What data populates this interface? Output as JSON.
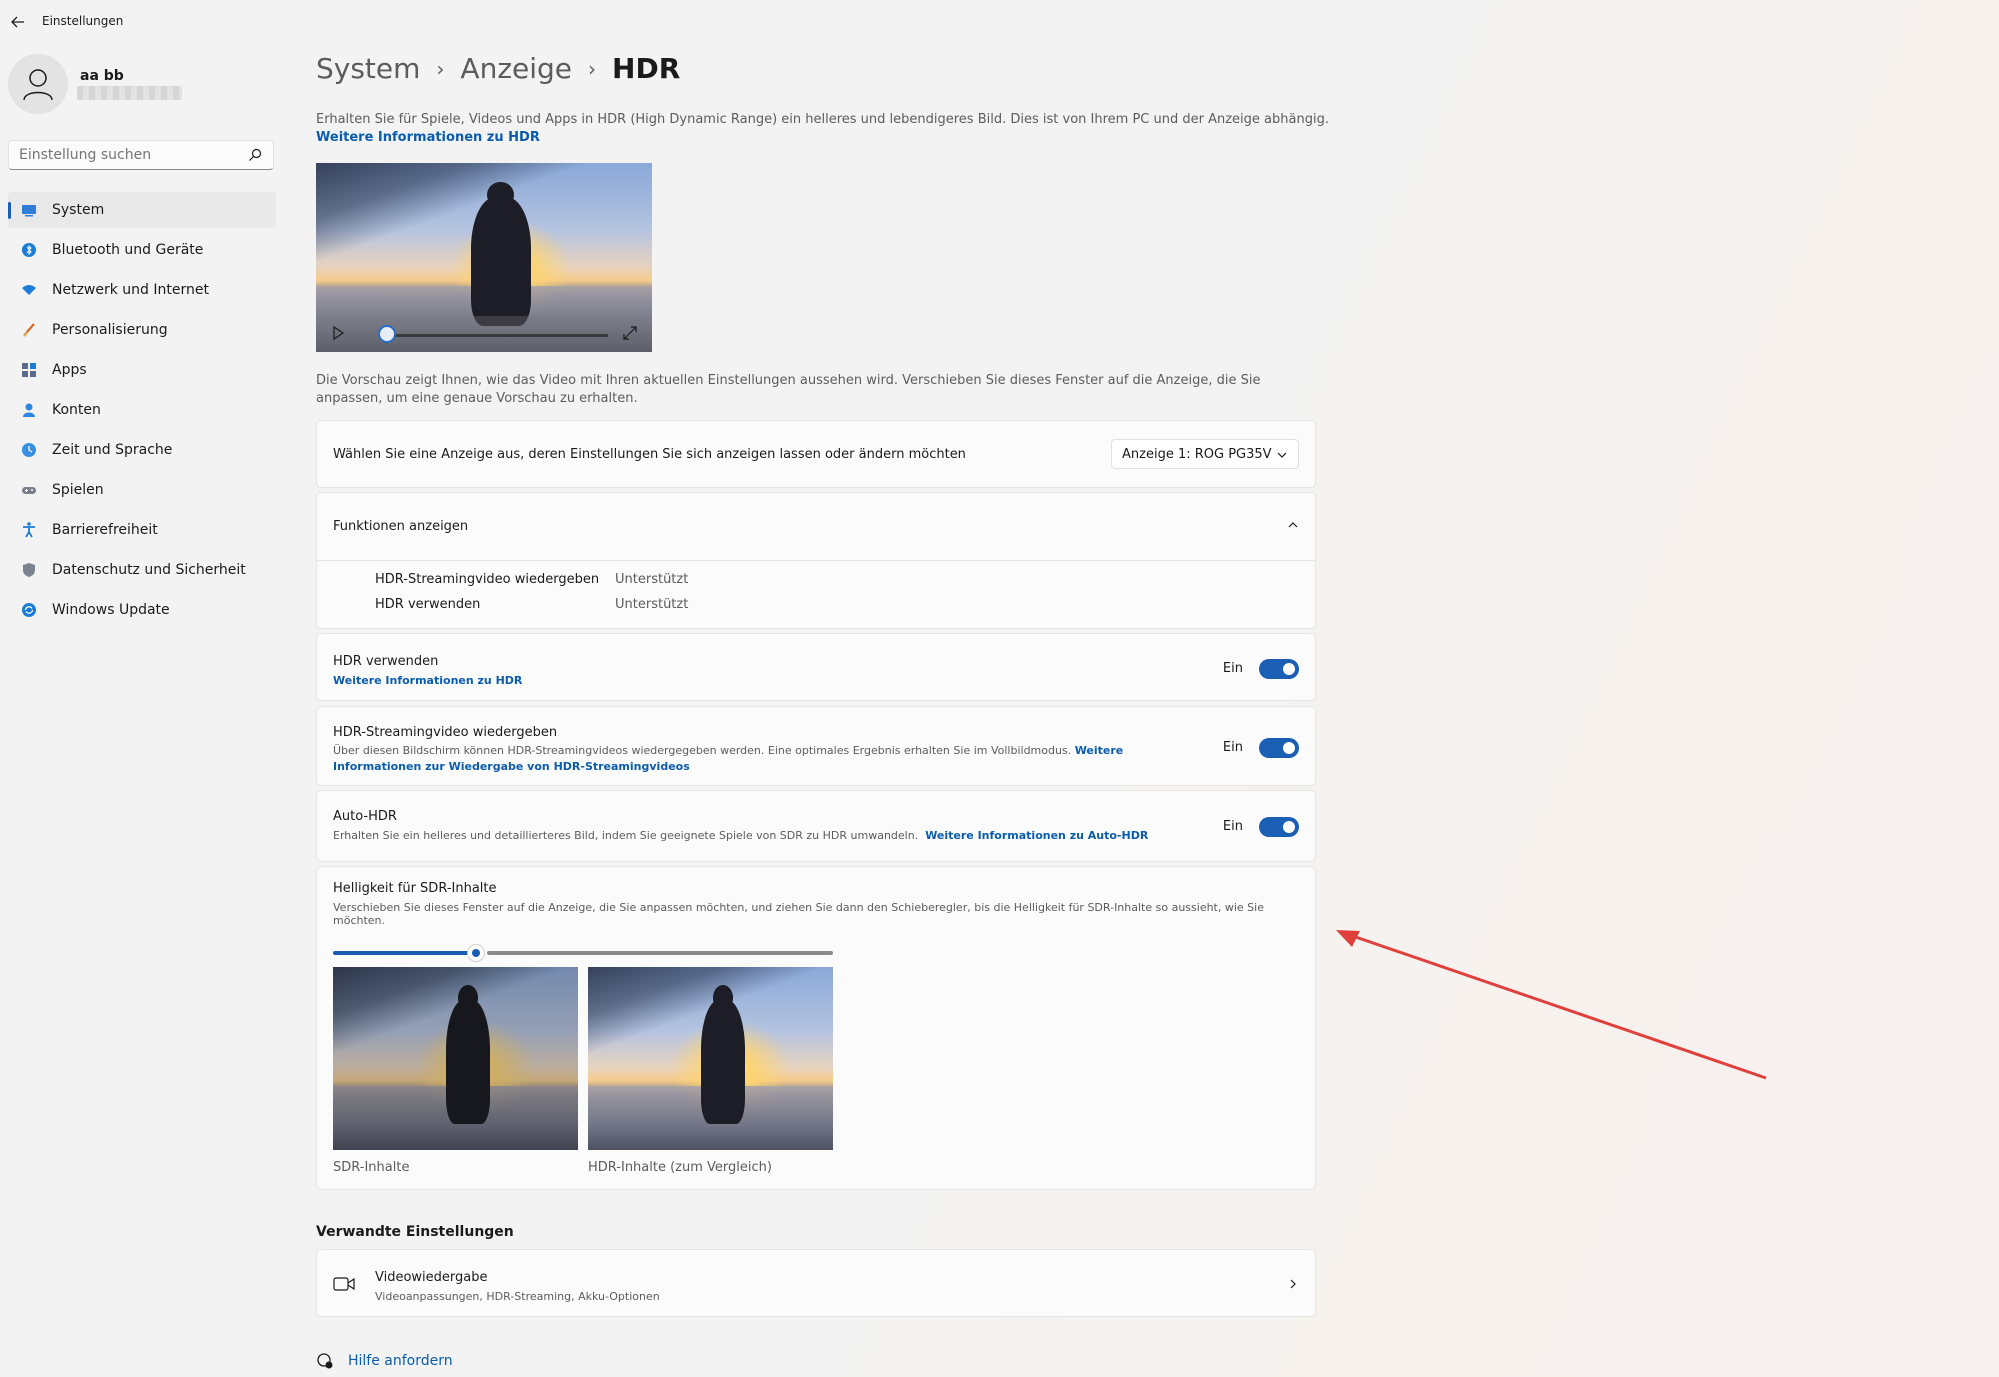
{
  "window": {
    "title": "Einstellungen"
  },
  "user": {
    "name": "aa bb"
  },
  "search": {
    "placeholder": "Einstellung suchen"
  },
  "sidebar": {
    "items": [
      {
        "label": "System",
        "icon": "monitor-icon",
        "active": true
      },
      {
        "label": "Bluetooth und Geräte",
        "icon": "bluetooth-icon"
      },
      {
        "label": "Netzwerk und Internet",
        "icon": "wifi-icon"
      },
      {
        "label": "Personalisierung",
        "icon": "brush-icon"
      },
      {
        "label": "Apps",
        "icon": "apps-icon"
      },
      {
        "label": "Konten",
        "icon": "person-icon"
      },
      {
        "label": "Zeit und Sprache",
        "icon": "globe-clock-icon"
      },
      {
        "label": "Spielen",
        "icon": "gamepad-icon"
      },
      {
        "label": "Barrierefreiheit",
        "icon": "accessibility-icon"
      },
      {
        "label": "Datenschutz und Sicherheit",
        "icon": "shield-icon"
      },
      {
        "label": "Windows Update",
        "icon": "update-icon"
      }
    ]
  },
  "breadcrumb": {
    "items": [
      "System",
      "Anzeige"
    ],
    "current": "HDR"
  },
  "intro": {
    "text": "Erhalten Sie für Spiele, Videos und Apps in HDR (High Dynamic Range) ein helleres und lebendigeres Bild. Dies ist von Ihrem PC und der Anzeige abhängig.",
    "link": "Weitere Informationen zu HDR"
  },
  "preview": {
    "description": "Die Vorschau zeigt Ihnen, wie das Video mit Ihren aktuellen Einstellungen aussehen wird. Verschieben Sie dieses Fenster auf die Anzeige, die Sie anpassen, um eine genaue Vorschau zu erhalten."
  },
  "display_select": {
    "label": "Wählen Sie eine Anzeige aus, deren Einstellungen Sie sich anzeigen lassen oder ändern möchten",
    "value": "Anzeige 1: ROG PG35V"
  },
  "capabilities": {
    "title": "Funktionen anzeigen",
    "rows": [
      {
        "name": "HDR-Streamingvideo wiedergeben",
        "value": "Unterstützt"
      },
      {
        "name": "HDR verwenden",
        "value": "Unterstützt"
      }
    ]
  },
  "settings": {
    "hdr": {
      "title": "HDR verwenden",
      "link": "Weitere Informationen zu HDR",
      "state": "Ein",
      "on": true
    },
    "streaming": {
      "title": "HDR-Streamingvideo wiedergeben",
      "desc": "Über diesen Bildschirm können HDR-Streamingvideos wiedergegeben werden. Eine optimales Ergebnis erhalten Sie im Vollbildmodus.",
      "link": "Weitere Informationen zur Wiedergabe von HDR-Streamingvideos",
      "state": "Ein",
      "on": true
    },
    "auto_hdr": {
      "title": "Auto-HDR",
      "desc": "Erhalten Sie ein helleres und detaillierteres Bild, indem Sie geeignete Spiele von SDR zu HDR umwandeln.",
      "link": "Weitere Informationen zu Auto-HDR",
      "state": "Ein",
      "on": true
    }
  },
  "sdr_brightness": {
    "title": "Helligkeit für SDR-Inhalte",
    "desc": "Verschieben Sie dieses Fenster auf die Anzeige, die Sie anpassen möchten, und ziehen Sie dann den Schieberegler, bis die Helligkeit für SDR-Inhalte so aussieht, wie Sie möchten.",
    "slider_fraction": 0.29,
    "caption_sdr": "SDR-Inhalte",
    "caption_hdr": "HDR-Inhalte (zum Vergleich)"
  },
  "related": {
    "header": "Verwandte Einstellungen",
    "video_playback": {
      "title": "Videowiedergabe",
      "subtitle": "Videoanpassungen, HDR-Streaming, Akku-Optionen"
    }
  },
  "help": {
    "label": "Hilfe anfordern"
  },
  "colors": {
    "accent": "#1a5fb4",
    "link": "#0b5cad",
    "annotation": "#e0403c"
  }
}
